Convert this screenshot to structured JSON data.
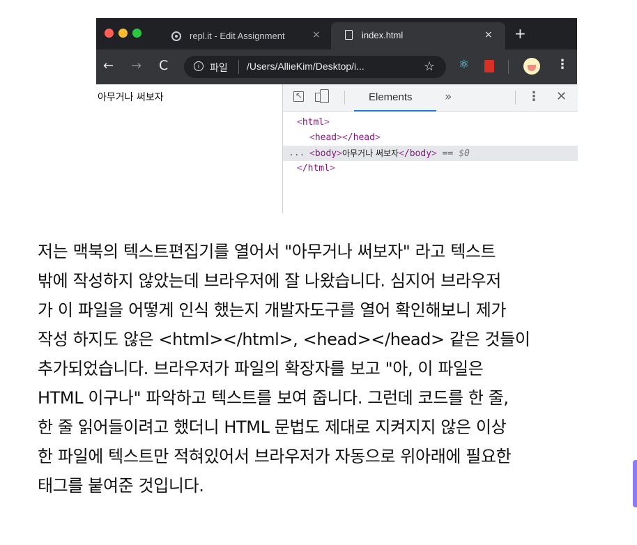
{
  "browser": {
    "tabs": [
      {
        "title": "repl.it - Edit Assignment",
        "favicon": "replit-icon",
        "close": "×"
      },
      {
        "title": "index.html",
        "favicon": "document-icon",
        "close": "×",
        "active": true
      }
    ],
    "new_tab": "+",
    "toolbar": {
      "back": "←",
      "forward": "→",
      "reload": "C",
      "info": "i",
      "scheme_label": "파일",
      "url": "/Users/AllieKim/Desktop/i...",
      "bookmark": "☆",
      "react_ext": "⚛",
      "menu": "⋮"
    }
  },
  "page": {
    "text": "아무거나 써보자"
  },
  "devtools": {
    "active_tab": "Elements",
    "more_tabs": "»",
    "kebab": "⋮",
    "close": "✕",
    "dom": {
      "ellipsis": "...",
      "html_open": "html",
      "head_open": "head",
      "head_close": "/head",
      "body_open": "body",
      "body_text": "아무거나 써보자",
      "body_close": "/body",
      "selected_marker": "== ",
      "selected_ref": "$0",
      "html_close": "/html"
    }
  },
  "article": {
    "lines": [
      "저는 맥북의 텍스트편집기를 열어서 \"아무거나 써보자\" 라고 텍스트",
      "밖에 작성하지 않았는데 브라우저에 잘 나왔습니다. 심지어 브라우저",
      "가 이 파일을 어떻게 인식 했는지 개발자도구를 열어 확인해보니 제가",
      "작성 하지도 않은 <html></html>, <head></head> 같은 것들이",
      "추가되었습니다. 브라우저가 파일의 확장자를 보고 \"아, 이 파일은",
      "HTML 이구나\" 파악하고 텍스트를 보여 줍니다. 그런데 코드를 한 줄,",
      "한 줄 읽어들이려고 했더니 HTML 문법도 제대로 지켜지지 않은 이상",
      "한 파일에 텍스트만 적혀있어서 브라우저가 자동으로 위아래에 필요한",
      "태그를 붙여준 것입니다."
    ]
  },
  "colors": {
    "tabbar": "#202124",
    "toolbar": "#35363a",
    "tag": "#881280",
    "selection": "#e6e7ea",
    "devtools_accent": "#1a73e8",
    "side_handle": "#8c7cf0"
  }
}
